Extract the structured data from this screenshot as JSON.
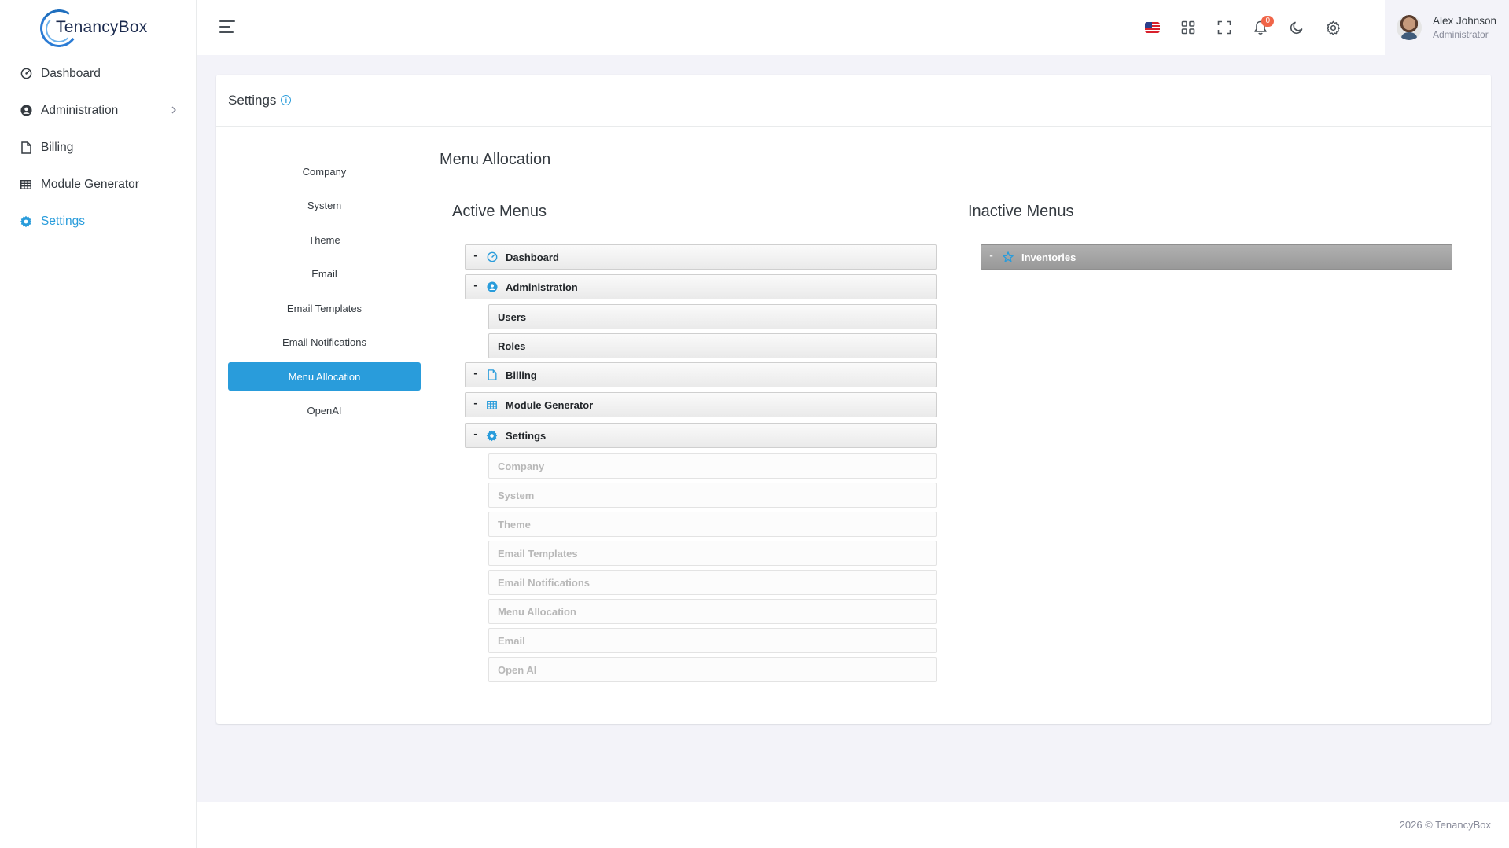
{
  "brand": {
    "name": "TenancyBox"
  },
  "sidebar": {
    "items": [
      {
        "label": "Dashboard",
        "icon": "speedometer-icon"
      },
      {
        "label": "Administration",
        "icon": "user-circle-icon"
      },
      {
        "label": "Billing",
        "icon": "file-icon"
      },
      {
        "label": "Module Generator",
        "icon": "grid-icon"
      },
      {
        "label": "Settings",
        "icon": "gear-icon"
      }
    ]
  },
  "topbar": {
    "notification_count": "0",
    "user": {
      "name": "Alex Johnson",
      "role": "Administrator"
    }
  },
  "page": {
    "title": "Settings"
  },
  "settings_nav": {
    "items": [
      "Company",
      "System",
      "Theme",
      "Email",
      "Email Templates",
      "Email Notifications",
      "Menu Allocation",
      "OpenAI"
    ],
    "active": "Menu Allocation"
  },
  "menu_allocation": {
    "title": "Menu Allocation",
    "active_title": "Active Menus",
    "inactive_title": "Inactive Menus",
    "active_menus": {
      "dashboard": "Dashboard",
      "administration": "Administration",
      "users": "Users",
      "roles": "Roles",
      "billing": "Billing",
      "module_generator": "Module Generator",
      "settings": "Settings",
      "settings_children": [
        "Company",
        "System",
        "Theme",
        "Email Templates",
        "Email Notifications",
        "Menu Allocation",
        "Email",
        "Open AI"
      ]
    },
    "inactive_menus": {
      "inventories": "Inventories"
    },
    "collapse_symbol": "-"
  },
  "footer": {
    "text": "2026 © TenancyBox"
  },
  "colors": {
    "accent": "#299cdb",
    "badge": "#f06548",
    "background": "#f3f3f9"
  }
}
